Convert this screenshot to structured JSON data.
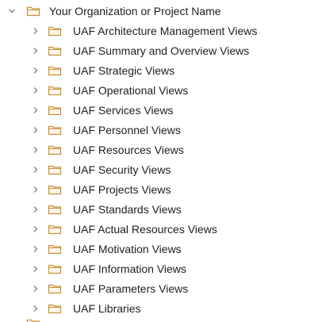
{
  "tree": {
    "root": {
      "label": "Your Organization or Project Name",
      "expanded": true,
      "icon": "folder-icon"
    },
    "children": [
      {
        "label": "UAF Architecture Management Views"
      },
      {
        "label": "UAF Summary and Overview Views"
      },
      {
        "label": "UAF Strategic Views"
      },
      {
        "label": "UAF Operational Views"
      },
      {
        "label": "UAF Services Views"
      },
      {
        "label": "UAF Personnel Views"
      },
      {
        "label": "UAF Resources Views"
      },
      {
        "label": "UAF Security Views"
      },
      {
        "label": "UAF Projects Views"
      },
      {
        "label": "UAF Standards Views"
      },
      {
        "label": "UAF Actual Resources Views"
      },
      {
        "label": "UAF Motivation Views"
      },
      {
        "label": "UAF Information Views"
      },
      {
        "label": "UAF Parameters Views"
      },
      {
        "label": "UAF Libraries"
      }
    ],
    "colors": {
      "folder_stroke": "#c8913a",
      "folder_fill": "#fdf6e9",
      "chevron": "#6e6e6e",
      "text": "#1e1e1e"
    }
  }
}
